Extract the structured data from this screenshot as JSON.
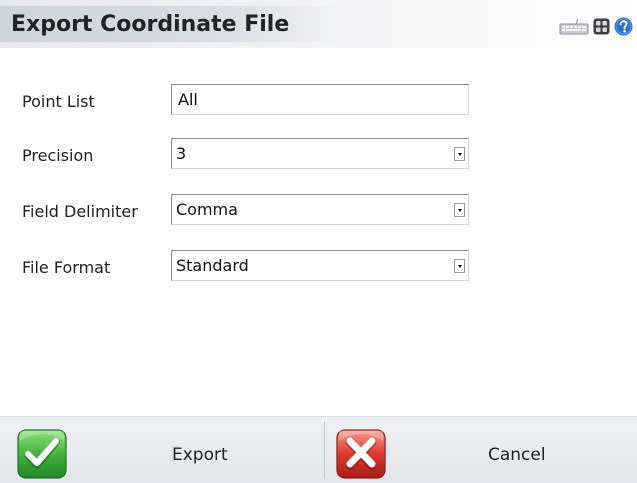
{
  "window": {
    "title": "Export Coordinate File"
  },
  "titlebar_icons": [
    {
      "name": "keyboard-icon"
    },
    {
      "name": "apps-grid-icon"
    },
    {
      "name": "help-icon",
      "color": "#2b6fd6"
    }
  ],
  "form": {
    "point_list": {
      "label": "Point List",
      "value": "All"
    },
    "precision": {
      "label": "Precision",
      "value": "3"
    },
    "field_delimiter": {
      "label": "Field Delimiter",
      "value": "Comma"
    },
    "file_format": {
      "label": "File Format",
      "value": "Standard"
    }
  },
  "buttons": {
    "export": {
      "label": "Export",
      "icon": "checkmark-icon",
      "color": "#3aa83a"
    },
    "cancel": {
      "label": "Cancel",
      "icon": "close-x-icon",
      "color": "#d8352f"
    }
  }
}
